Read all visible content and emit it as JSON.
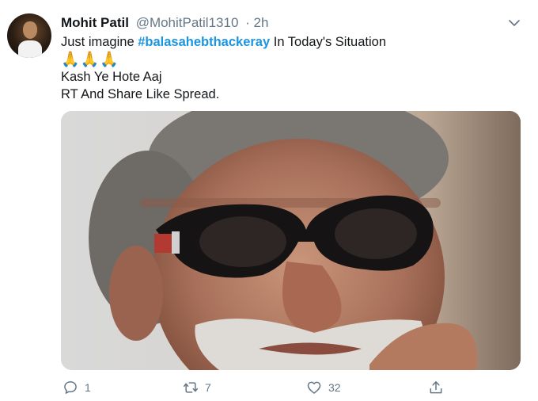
{
  "tweet": {
    "author_name": "Mohit Patil",
    "author_handle": "@MohitPatil1310",
    "time": "· 2h",
    "line1_prefix": "Just imagine ",
    "hashtag": "#balasahebthackeray",
    "line1_suffix": " In Today's Situation",
    "emojis": [
      "🙏",
      "🙏",
      "🙏"
    ],
    "line2": "Kash Ye Hote Aaj",
    "line3": "RT And Share Like Spread."
  },
  "actions": {
    "reply_count": "1",
    "retweet_count": "7",
    "like_count": "32"
  },
  "icons": {
    "reply": "speech-bubble-icon",
    "retweet": "retweet-icon",
    "like": "heart-icon",
    "share": "share-upload-icon",
    "menu": "chevron-down-icon"
  },
  "colors": {
    "link": "#1b95e0",
    "muted": "#657786",
    "text": "#14171a"
  }
}
